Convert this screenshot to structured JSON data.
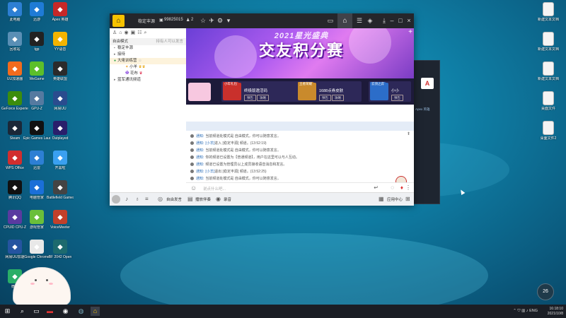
{
  "desktop": {
    "left_icons": [
      {
        "label": "此电脑",
        "icon": "computer-icon",
        "color": "#2d7fd4"
      },
      {
        "label": "迅游",
        "icon": "xunyou-icon",
        "color": "#1f7bd6"
      },
      {
        "label": "Apex 英雄",
        "icon": "apex-icon",
        "color": "#c62828"
      },
      {
        "label": "回收站",
        "icon": "recycle-bin-icon",
        "color": "#5a8fb5"
      },
      {
        "label": "tgp",
        "icon": "tgp-icon",
        "color": "#222"
      },
      {
        "label": "YY语音",
        "icon": "yy-icon",
        "color": "#f4b400"
      },
      {
        "label": "UU加速器",
        "icon": "uu-icon",
        "color": "#f26b1d"
      },
      {
        "label": "WeGame",
        "icon": "wegame-icon",
        "color": "#5cbf2a"
      },
      {
        "label": "英雄联盟",
        "icon": "lol-icon",
        "color": "#2b2b2b"
      },
      {
        "label": "GeForce Experience",
        "icon": "nvidia-icon",
        "color": "#3c8d0d"
      },
      {
        "label": "GPU-Z",
        "icon": "gpuz-icon",
        "color": "#557aa0"
      },
      {
        "label": "网易UU",
        "icon": "uu2-icon",
        "color": "#2a4c8e"
      },
      {
        "label": "Steam",
        "icon": "steam-icon",
        "color": "#1b2838"
      },
      {
        "label": "Epic Games Launcher",
        "icon": "epic-icon",
        "color": "#111"
      },
      {
        "label": "Outplayed",
        "icon": "outplayed-icon",
        "color": "#2a1f6b"
      },
      {
        "label": "WPS Office",
        "icon": "wps-icon",
        "color": "#d12e2e"
      },
      {
        "label": "迅雷",
        "icon": "thunder-icon",
        "color": "#2d7fd4"
      },
      {
        "label": "开黑啦",
        "icon": "kook-icon",
        "color": "#3aa0f0"
      },
      {
        "label": "腾讯QQ",
        "icon": "qq-icon",
        "color": "#111"
      },
      {
        "label": "电脑管家",
        "icon": "pcmgr-icon",
        "color": "#1b6fd8"
      },
      {
        "label": "Battlefield Games",
        "icon": "bf-icon",
        "color": "#444"
      },
      {
        "label": "CPUID CPU-Z",
        "icon": "cpuz-icon",
        "color": "#5a3aa0"
      },
      {
        "label": "游戏管家",
        "icon": "gamemgr-icon",
        "color": "#6abf3a"
      },
      {
        "label": "VoiceMeeter",
        "icon": "voicemeeter-icon",
        "color": "#c2402a"
      },
      {
        "label": "网易UU加速",
        "icon": "netease-icon",
        "color": "#2554a0"
      },
      {
        "label": "Google Chrome",
        "icon": "chrome-icon",
        "color": "#e8e8e8"
      },
      {
        "label": "BF 2042 Open",
        "icon": "bf2042-icon",
        "color": "#1d6a6e"
      },
      {
        "label": "微信",
        "icon": "wechat-icon",
        "color": "#2aae67"
      }
    ],
    "right_icons": [
      {
        "label": "新建文本文档"
      },
      {
        "label": "新建文本文档"
      },
      {
        "label": "新建文本文档"
      },
      {
        "label": "桌面文件"
      },
      {
        "label": "桌面文件2"
      }
    ]
  },
  "window": {
    "title": "稳定丰源",
    "id": "99825015",
    "count": "2",
    "left_panel": {
      "header_label": "自由模式",
      "header_right": "持有人可以发言",
      "rows": [
        {
          "label": "稳定丰源"
        },
        {
          "label": "接待"
        },
        {
          "label": "大佬训练营"
        },
        {
          "label": "小羊"
        },
        {
          "label": "花布"
        },
        {
          "label": "蓝军通讯频道"
        }
      ]
    },
    "banner": {
      "line1": "2021星光盛典",
      "line2": "交友积分赛"
    },
    "events": [
      {
        "tag": "小年礼包",
        "title": "终极版邀活码",
        "btn1": "预告",
        "btn2": "攻略",
        "color": "#c9302c"
      },
      {
        "tag": "王者荣耀",
        "title": "1688点券皮肤",
        "btn1": "预告",
        "btn2": "攻略",
        "color": "#c98a2c"
      },
      {
        "tag": "云顶之弈",
        "title": "小小",
        "btn1": "预告",
        "btn2": "",
        "color": "#2c6dc9"
      }
    ],
    "messages": [
      {
        "label": "通知:",
        "user": "",
        "text": "当前频道处模式是 自由模式，你可以随意发言。"
      },
      {
        "label": "通知:",
        "user": "[小羊]",
        "text": "进入 [稳定丰源] 频道。(13:52:19)"
      },
      {
        "label": "通知:",
        "user": "",
        "text": "当前频道处模式是 自由模式，你可以随意发言。"
      },
      {
        "label": "通知:",
        "user": "",
        "text": "你的频道已设置为【普通频道】，用户在这里可以与人互动。"
      },
      {
        "label": "通知:",
        "user": "",
        "text": "频道已设置为管理员以上成员接收语音消息和发言。"
      },
      {
        "label": "通知:",
        "user": "[小羊]",
        "text": "退出 [稳定丰源] 频道。(13:52:25)"
      },
      {
        "label": "通知:",
        "user": "",
        "text": "当前频道处模式是 自由模式，你可以随意发言。"
      }
    ],
    "input_placeholder": "说点什么吧...",
    "bottom": {
      "free_mode": "自由发言",
      "record": "播放伴奏",
      "settings": "录音",
      "app_center": "应用中心"
    }
  },
  "bg_window": {
    "label": "Apex 英雄"
  },
  "taskbar": {
    "lang": "ENG",
    "time": "16:18:10",
    "date": "2021/10/8"
  },
  "weather": {
    "temp": "26"
  }
}
